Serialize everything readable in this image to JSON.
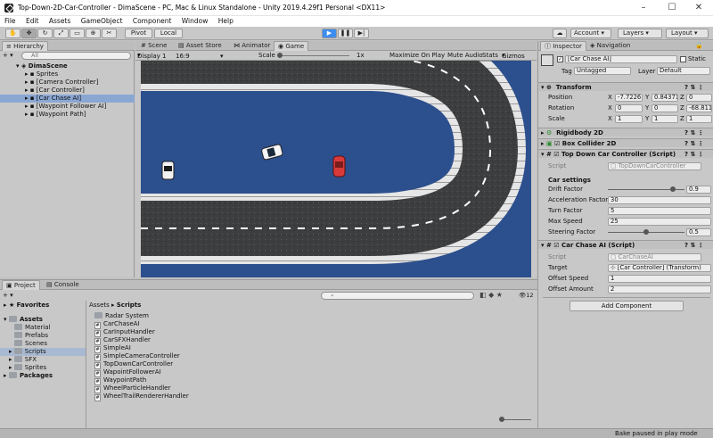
{
  "window": {
    "title": "Top-Down-2D-Car-Controller - DimaScene - PC, Mac & Linux Standalone - Unity 2019.4.29f1 Personal <DX11>"
  },
  "menu": [
    "File",
    "Edit",
    "Assets",
    "GameObject",
    "Component",
    "Window",
    "Help"
  ],
  "toolbar": {
    "pivot": "Pivot",
    "local": "Local",
    "account": "Account",
    "layers": "Layers",
    "layout": "Layout"
  },
  "hierarchy": {
    "tab": "Hierarchy",
    "search_placeholder": "All",
    "scene": "DimaScene",
    "items": [
      "Sprites",
      "[Camera Controller]",
      "[Car Controller]",
      "[Car Chase AI]",
      "[Waypoint Follower AI]",
      "[Waypoint Path]"
    ]
  },
  "scene_tabs": {
    "scene": "Scene",
    "asset_store": "Asset Store",
    "animator": "Animator",
    "game": "Game"
  },
  "game_bar": {
    "display": "Display 1",
    "aspect": "16:9",
    "scale_label": "Scale",
    "scale_value": "1x",
    "maximize": "Maximize On Play",
    "mute": "Mute Audio",
    "stats": "Stats",
    "gizmos": "Gizmos"
  },
  "inspector": {
    "tab": "Inspector",
    "nav_tab": "Navigation",
    "object_name": "[Car Chase AI]",
    "static_label": "Static",
    "tag_label": "Tag",
    "tag_value": "Untagged",
    "layer_label": "Layer",
    "layer_value": "Default",
    "transform": {
      "title": "Transform",
      "position_label": "Position",
      "position": [
        "-7.7226",
        "0.84371",
        "0"
      ],
      "rotation_label": "Rotation",
      "rotation": [
        "0",
        "0",
        "-68.811"
      ],
      "scale_label": "Scale",
      "scale": [
        "1",
        "1",
        "1"
      ]
    },
    "rigidbody": "Rigidbody 2D",
    "box_collider": "Box Collider 2D",
    "car_controller": {
      "title": "Top Down Car Controller (Script)",
      "script_label": "Script",
      "script_value": "TopDownCarController",
      "section": "Car settings",
      "fields": [
        {
          "label": "Drift Factor",
          "value": "0.9",
          "slider": 0.9
        },
        {
          "label": "Acceleration Factor",
          "value": "30"
        },
        {
          "label": "Turn Factor",
          "value": "5"
        },
        {
          "label": "Max Speed",
          "value": "25"
        },
        {
          "label": "Steering Factor",
          "value": "0.5",
          "slider": 0.5
        }
      ]
    },
    "chase_ai": {
      "title": "Car Chase AI (Script)",
      "script_label": "Script",
      "script_value": "CarChaseAI",
      "target_label": "Target",
      "target_value": "[Car Controller] (Transform)",
      "offset_speed_label": "Offset Speed",
      "offset_speed": "1",
      "offset_amount_label": "Offset Amount",
      "offset_amount": "2"
    },
    "add_component": "Add Component",
    "xyz": [
      "X",
      "Y",
      "Z"
    ]
  },
  "project": {
    "tab": "Project",
    "console_tab": "Console",
    "favorites": "Favorites",
    "assets": "Assets",
    "folders": [
      "Material",
      "Prefabs",
      "Scenes",
      "Scripts",
      "SFX",
      "Sprites"
    ],
    "packages": "Packages",
    "breadcrumb_root": "Assets",
    "breadcrumb_current": "Scripts",
    "file_count": "12",
    "items": [
      {
        "name": "Radar System",
        "type": "folder"
      },
      {
        "name": "CarChaseAI",
        "type": "script"
      },
      {
        "name": "CarInputHandler",
        "type": "script"
      },
      {
        "name": "CarSFXHandler",
        "type": "script"
      },
      {
        "name": "SimpleAI",
        "type": "script"
      },
      {
        "name": "SimpleCameraController",
        "type": "script"
      },
      {
        "name": "TopDownCarController",
        "type": "script"
      },
      {
        "name": "WapointFollowerAI",
        "type": "script"
      },
      {
        "name": "WaypointPath",
        "type": "script"
      },
      {
        "name": "WheelParticleHandler",
        "type": "script"
      },
      {
        "name": "WheelTrailRendererHandler",
        "type": "script"
      }
    ]
  },
  "status": {
    "bake": "Bake paused in play mode"
  }
}
